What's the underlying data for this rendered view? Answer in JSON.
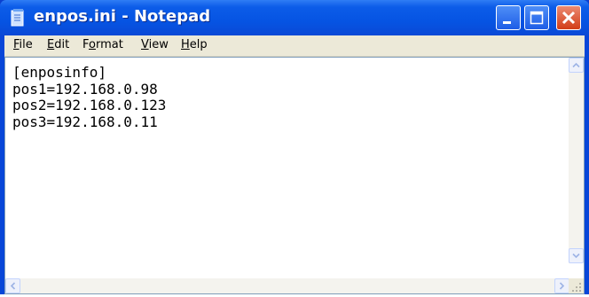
{
  "window": {
    "title": "enpos.ini - Notepad"
  },
  "menubar": {
    "items": [
      {
        "key": "F",
        "rest": "ile"
      },
      {
        "key": "E",
        "rest": "dit"
      },
      {
        "key": "",
        "pre": "F",
        "mid": "o",
        "post": "rmat"
      },
      {
        "key": "V",
        "rest": "iew"
      },
      {
        "key": "H",
        "rest": "elp"
      }
    ]
  },
  "editor": {
    "lines": [
      "[enposinfo]",
      "pos1=192.168.0.98",
      "pos2=192.168.0.123",
      "pos3=192.168.0.11"
    ]
  },
  "icons": {
    "app": "notepad-icon",
    "minimize": "minimize-icon",
    "maximize": "maximize-icon",
    "close": "close-icon"
  }
}
